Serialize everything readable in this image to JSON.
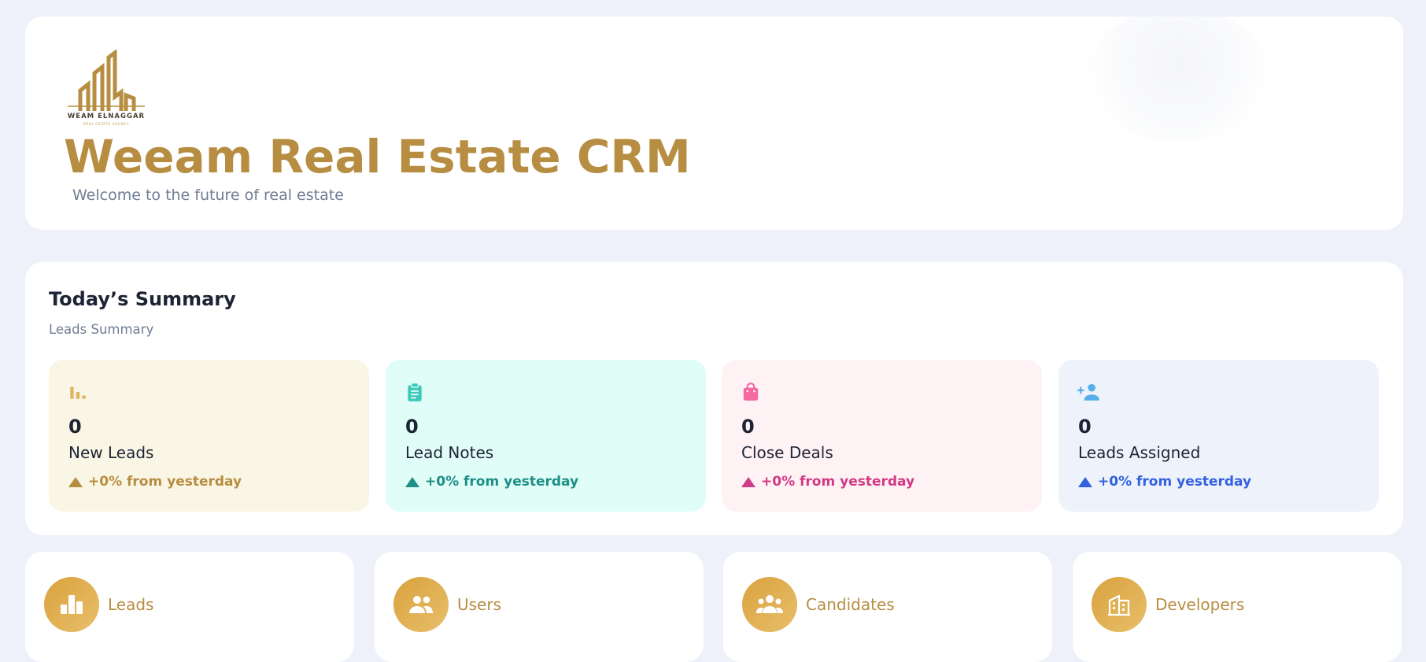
{
  "header": {
    "logo_name": "WEAM ELNAGGAR",
    "logo_tagline": "REAL ESTATE AGENCY",
    "title": "Weeam Real Estate CRM",
    "subtitle": "Welcome to the future of real estate",
    "accent_color": "#b78d42"
  },
  "summary": {
    "title": "Today’s Summary",
    "subtitle": "Leads Summary",
    "cards": [
      {
        "icon": "bar-chart-icon",
        "value": "0",
        "label": "New Leads",
        "trend": "+0% from yesterday",
        "bg": "#faf6e5",
        "color": "#b78d42",
        "icon_color": "#e0b460"
      },
      {
        "icon": "clipboard-icon",
        "value": "0",
        "label": "Lead Notes",
        "trend": "+0% from yesterday",
        "bg": "#e1fdf8",
        "color": "#1e8f86",
        "icon_color": "#3cc9b9"
      },
      {
        "icon": "shopping-bag-icon",
        "value": "0",
        "label": "Close Deals",
        "trend": "+0% from yesterday",
        "bg": "#fff2f4",
        "color": "#d13a84",
        "icon_color": "#f36aa3"
      },
      {
        "icon": "person-add-icon",
        "value": "0",
        "label": "Leads Assigned",
        "trend": "+0% from yesterday",
        "bg": "#edf2fb",
        "color": "#3461e0",
        "icon_color": "#57aee8"
      }
    ]
  },
  "nav": [
    {
      "icon": "bar-chart-icon",
      "label": "Leads"
    },
    {
      "icon": "users-icon",
      "label": "Users"
    },
    {
      "icon": "candidates-icon",
      "label": "Candidates"
    },
    {
      "icon": "building-icon",
      "label": "Developers"
    }
  ]
}
